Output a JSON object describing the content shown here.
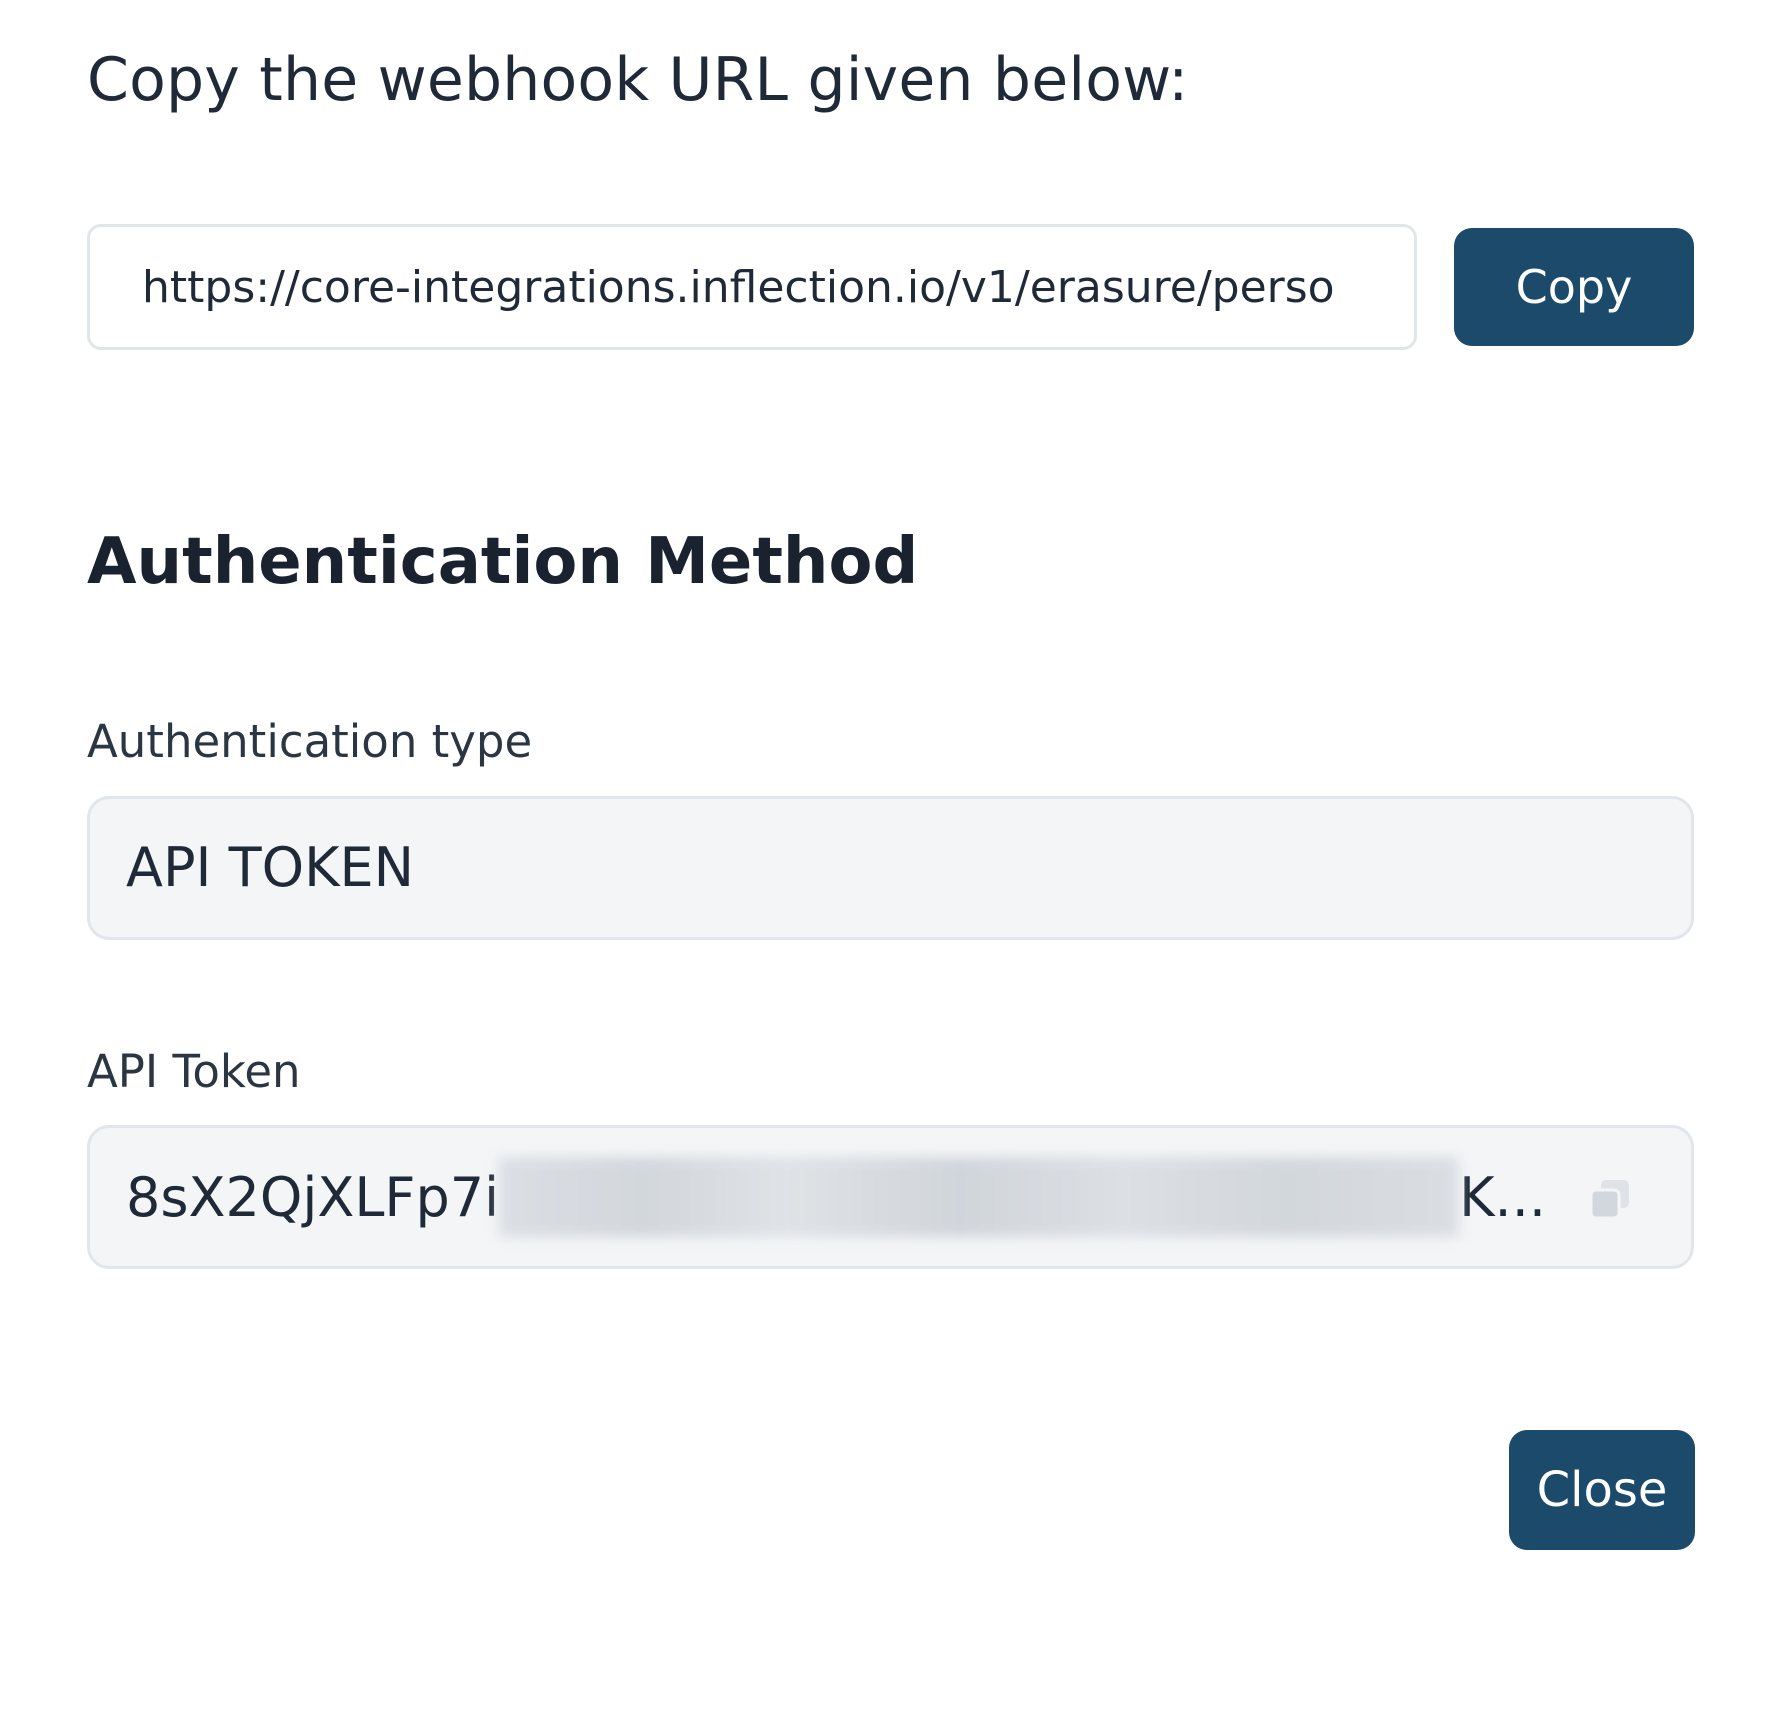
{
  "webhook": {
    "instruction": "Copy the webhook URL given below:",
    "url_value": "https://core-integrations.inflection.io/v1/erasure/perso",
    "copy_label": "Copy"
  },
  "auth": {
    "heading": "Authentication Method",
    "type_label": "Authentication type",
    "type_value": "API TOKEN",
    "token_label": "API Token",
    "token_prefix": "8sX2QjXLFp7i",
    "token_suffix": "K..."
  },
  "footer": {
    "close_label": "Close"
  },
  "colors": {
    "primary_button": "#1b4a6b",
    "field_background": "#f3f5f7",
    "field_border": "#e2e6ea"
  },
  "icons": {
    "token_copy": "copy-icon"
  }
}
